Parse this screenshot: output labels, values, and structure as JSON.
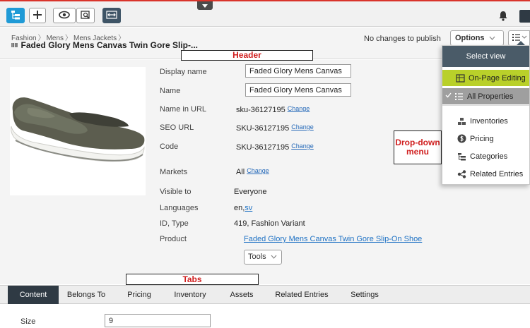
{
  "toolbar": {
    "buttons": [
      {
        "icon": "navigation-tree-icon",
        "active": true
      },
      {
        "icon": "plus-icon"
      },
      {
        "icon": "eye-icon"
      },
      {
        "icon": "preview-search-icon"
      },
      {
        "icon": "compare-arrows-icon"
      }
    ],
    "notification_icon": "bell-icon",
    "collapse_icon": "chevron-down-icon"
  },
  "header": {
    "breadcrumb": [
      "Fashion",
      "Mens",
      "Mens Jackets"
    ],
    "breadcrumb_separator": "〉",
    "title": "Faded Glory Mens Canvas Twin Gore Slip-...",
    "status": "No changes to publish",
    "options_label": "Options",
    "view_icon": "list-view-icon"
  },
  "callouts": {
    "header": "Header",
    "tabs": "Tabs",
    "menu": "Drop-down menu"
  },
  "fields": {
    "display_name": {
      "label": "Display name",
      "value": "Faded Glory Mens Canvas"
    },
    "name": {
      "label": "Name",
      "value": "Faded Glory Mens Canvas"
    },
    "name_in_url": {
      "label": "Name in URL",
      "value": "sku-36127195",
      "action": "Change"
    },
    "seo_url": {
      "label": "SEO URL",
      "value": "SKU-36127195",
      "action": "Change"
    },
    "code": {
      "label": "Code",
      "value": "SKU-36127195",
      "action": "Change"
    },
    "markets": {
      "label": "Markets",
      "value": "All",
      "action": "Change"
    },
    "visible_to": {
      "label": "Visible to",
      "value": "Everyone"
    },
    "languages": {
      "label": "Languages",
      "value_plain": "en,",
      "value_link": "sv"
    },
    "id_type": {
      "label": "ID, Type",
      "value": "419, Fashion Variant"
    },
    "product": {
      "label": "Product",
      "value": "Faded Glory Mens Canvas Twin Gore Slip-On Shoe"
    }
  },
  "tools_label": "Tools",
  "view_menu": {
    "heading": "Select view",
    "modes": [
      {
        "label": "On-Page Editing",
        "icon": "on-page-editing-icon",
        "highlight": "#b9d02a"
      },
      {
        "label": "All Properties",
        "icon": "list-icon",
        "selected": true
      }
    ],
    "items": [
      {
        "label": "Inventories",
        "icon": "inventories-icon"
      },
      {
        "label": "Pricing",
        "icon": "dollar-icon"
      },
      {
        "label": "Categories",
        "icon": "categories-icon"
      },
      {
        "label": "Related Entries",
        "icon": "share-icon"
      }
    ]
  },
  "tabs": [
    "Content",
    "Belongs To",
    "Pricing",
    "Inventory",
    "Assets",
    "Related Entries",
    "Settings"
  ],
  "active_tab": "Content",
  "size": {
    "label": "Size",
    "value": "9"
  },
  "colors": {
    "accent": "#1f9ad6",
    "dark": "#2f3a44",
    "menu_header": "#4a5b68",
    "link": "#1f72c4",
    "callout_text": "#d01f1f"
  }
}
